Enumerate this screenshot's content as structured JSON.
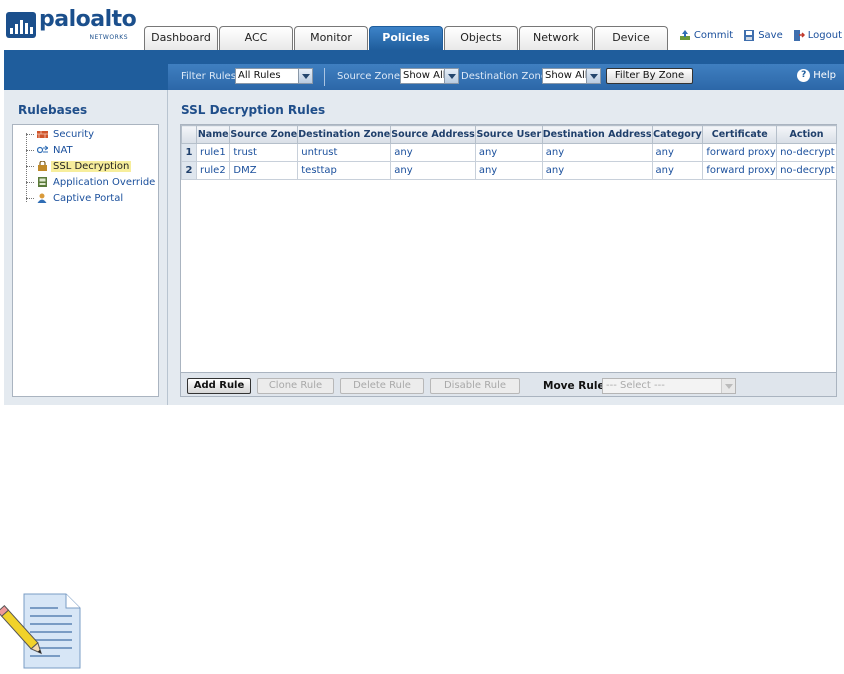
{
  "brand": {
    "name": "paloalto",
    "sub": "NETWORKS"
  },
  "nav": {
    "tabs": [
      "Dashboard",
      "ACC",
      "Monitor",
      "Policies",
      "Objects",
      "Network",
      "Device"
    ],
    "active": "Policies"
  },
  "actions": {
    "commit": "Commit",
    "save": "Save",
    "logout": "Logout"
  },
  "filter": {
    "filter_rules_label": "Filter Rules",
    "filter_rules_value": "All Rules",
    "source_zone_label": "Source Zone",
    "source_zone_value": "Show All",
    "destination_zone_label": "Destination Zone",
    "destination_zone_value": "Show All",
    "filter_by_zone_button": "Filter By Zone",
    "help": "Help"
  },
  "sidebar": {
    "title": "Rulebases",
    "items": [
      {
        "label": "Security",
        "icon": "security-wall-icon"
      },
      {
        "label": "NAT",
        "icon": "nat-icon"
      },
      {
        "label": "SSL Decryption",
        "icon": "ssl-lock-icon",
        "selected": true
      },
      {
        "label": "Application Override",
        "icon": "application-override-icon"
      },
      {
        "label": "Captive Portal",
        "icon": "captive-portal-icon"
      }
    ]
  },
  "main": {
    "title": "SSL Decryption Rules",
    "columns": [
      "",
      "Name",
      "Source Zone",
      "Destination Zone",
      "Source Address",
      "Source User",
      "Destination Address",
      "Category",
      "Certificate",
      "Action"
    ],
    "rows": [
      [
        "1",
        "rule1",
        "trust",
        "untrust",
        "any",
        "any",
        "any",
        "any",
        "forward proxy",
        "no-decrypt"
      ],
      [
        "2",
        "rule2",
        "DMZ",
        "testtap",
        "any",
        "any",
        "any",
        "any",
        "forward proxy",
        "no-decrypt"
      ]
    ],
    "buttons": {
      "add": "Add Rule",
      "clone": "Clone Rule",
      "delete": "Delete Rule",
      "disable": "Disable Rule"
    },
    "move_rule_label": "Move Rule",
    "move_rule_placeholder": "--- Select ---"
  },
  "colors": {
    "brand_blue": "#1f5d9c",
    "link": "#1a4f9c",
    "selection": "#f7ee9c"
  }
}
